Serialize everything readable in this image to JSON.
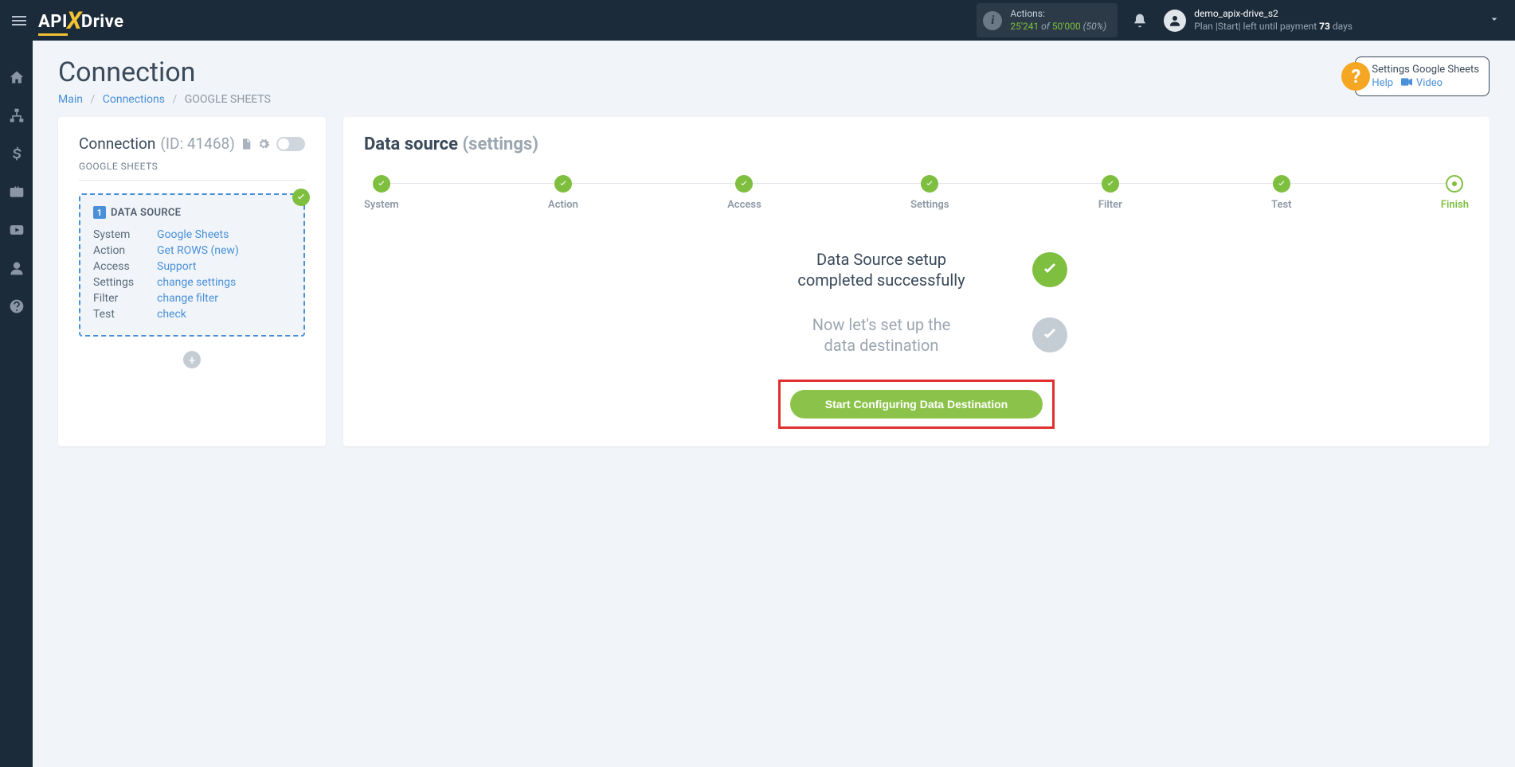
{
  "topbar": {
    "logo": {
      "api": "API",
      "x": "X",
      "drive": "Drive"
    },
    "actions": {
      "label": "Actions:",
      "count": "25'241",
      "of": " of ",
      "max": "50'000",
      "pct": " (50%)"
    },
    "user": {
      "name": "demo_apix-drive_s2",
      "plan_prefix": "Plan |Start| left until payment ",
      "days_num": "73",
      "days_sfx": " days"
    }
  },
  "page": {
    "title": "Connection",
    "breadcrumb": {
      "main": "Main",
      "connections": "Connections",
      "current": "GOOGLE SHEETS"
    },
    "help": {
      "title": "Settings Google Sheets",
      "help": "Help",
      "video": "Video"
    }
  },
  "left": {
    "title": "Connection",
    "id": "(ID: 41468)",
    "subtitle": "GOOGLE SHEETS",
    "ds_heading": "DATA SOURCE",
    "rows": {
      "system": {
        "k": "System",
        "v": "Google Sheets"
      },
      "action": {
        "k": "Action",
        "v": "Get ROWS (new)"
      },
      "access": {
        "k": "Access",
        "v": "Support"
      },
      "settings": {
        "k": "Settings",
        "v": "change settings"
      },
      "filter": {
        "k": "Filter",
        "v": "change filter"
      },
      "test": {
        "k": "Test",
        "v": "check"
      }
    }
  },
  "right": {
    "title": "Data source",
    "title_sub": " (settings)",
    "steps": {
      "system": "System",
      "action": "Action",
      "access": "Access",
      "settings": "Settings",
      "filter": "Filter",
      "test": "Test",
      "finish": "Finish"
    },
    "status1_line1": "Data Source setup",
    "status1_line2": "completed successfully",
    "status2_line1": "Now let's set up the",
    "status2_line2": "data destination",
    "cta": "Start Configuring Data Destination"
  }
}
